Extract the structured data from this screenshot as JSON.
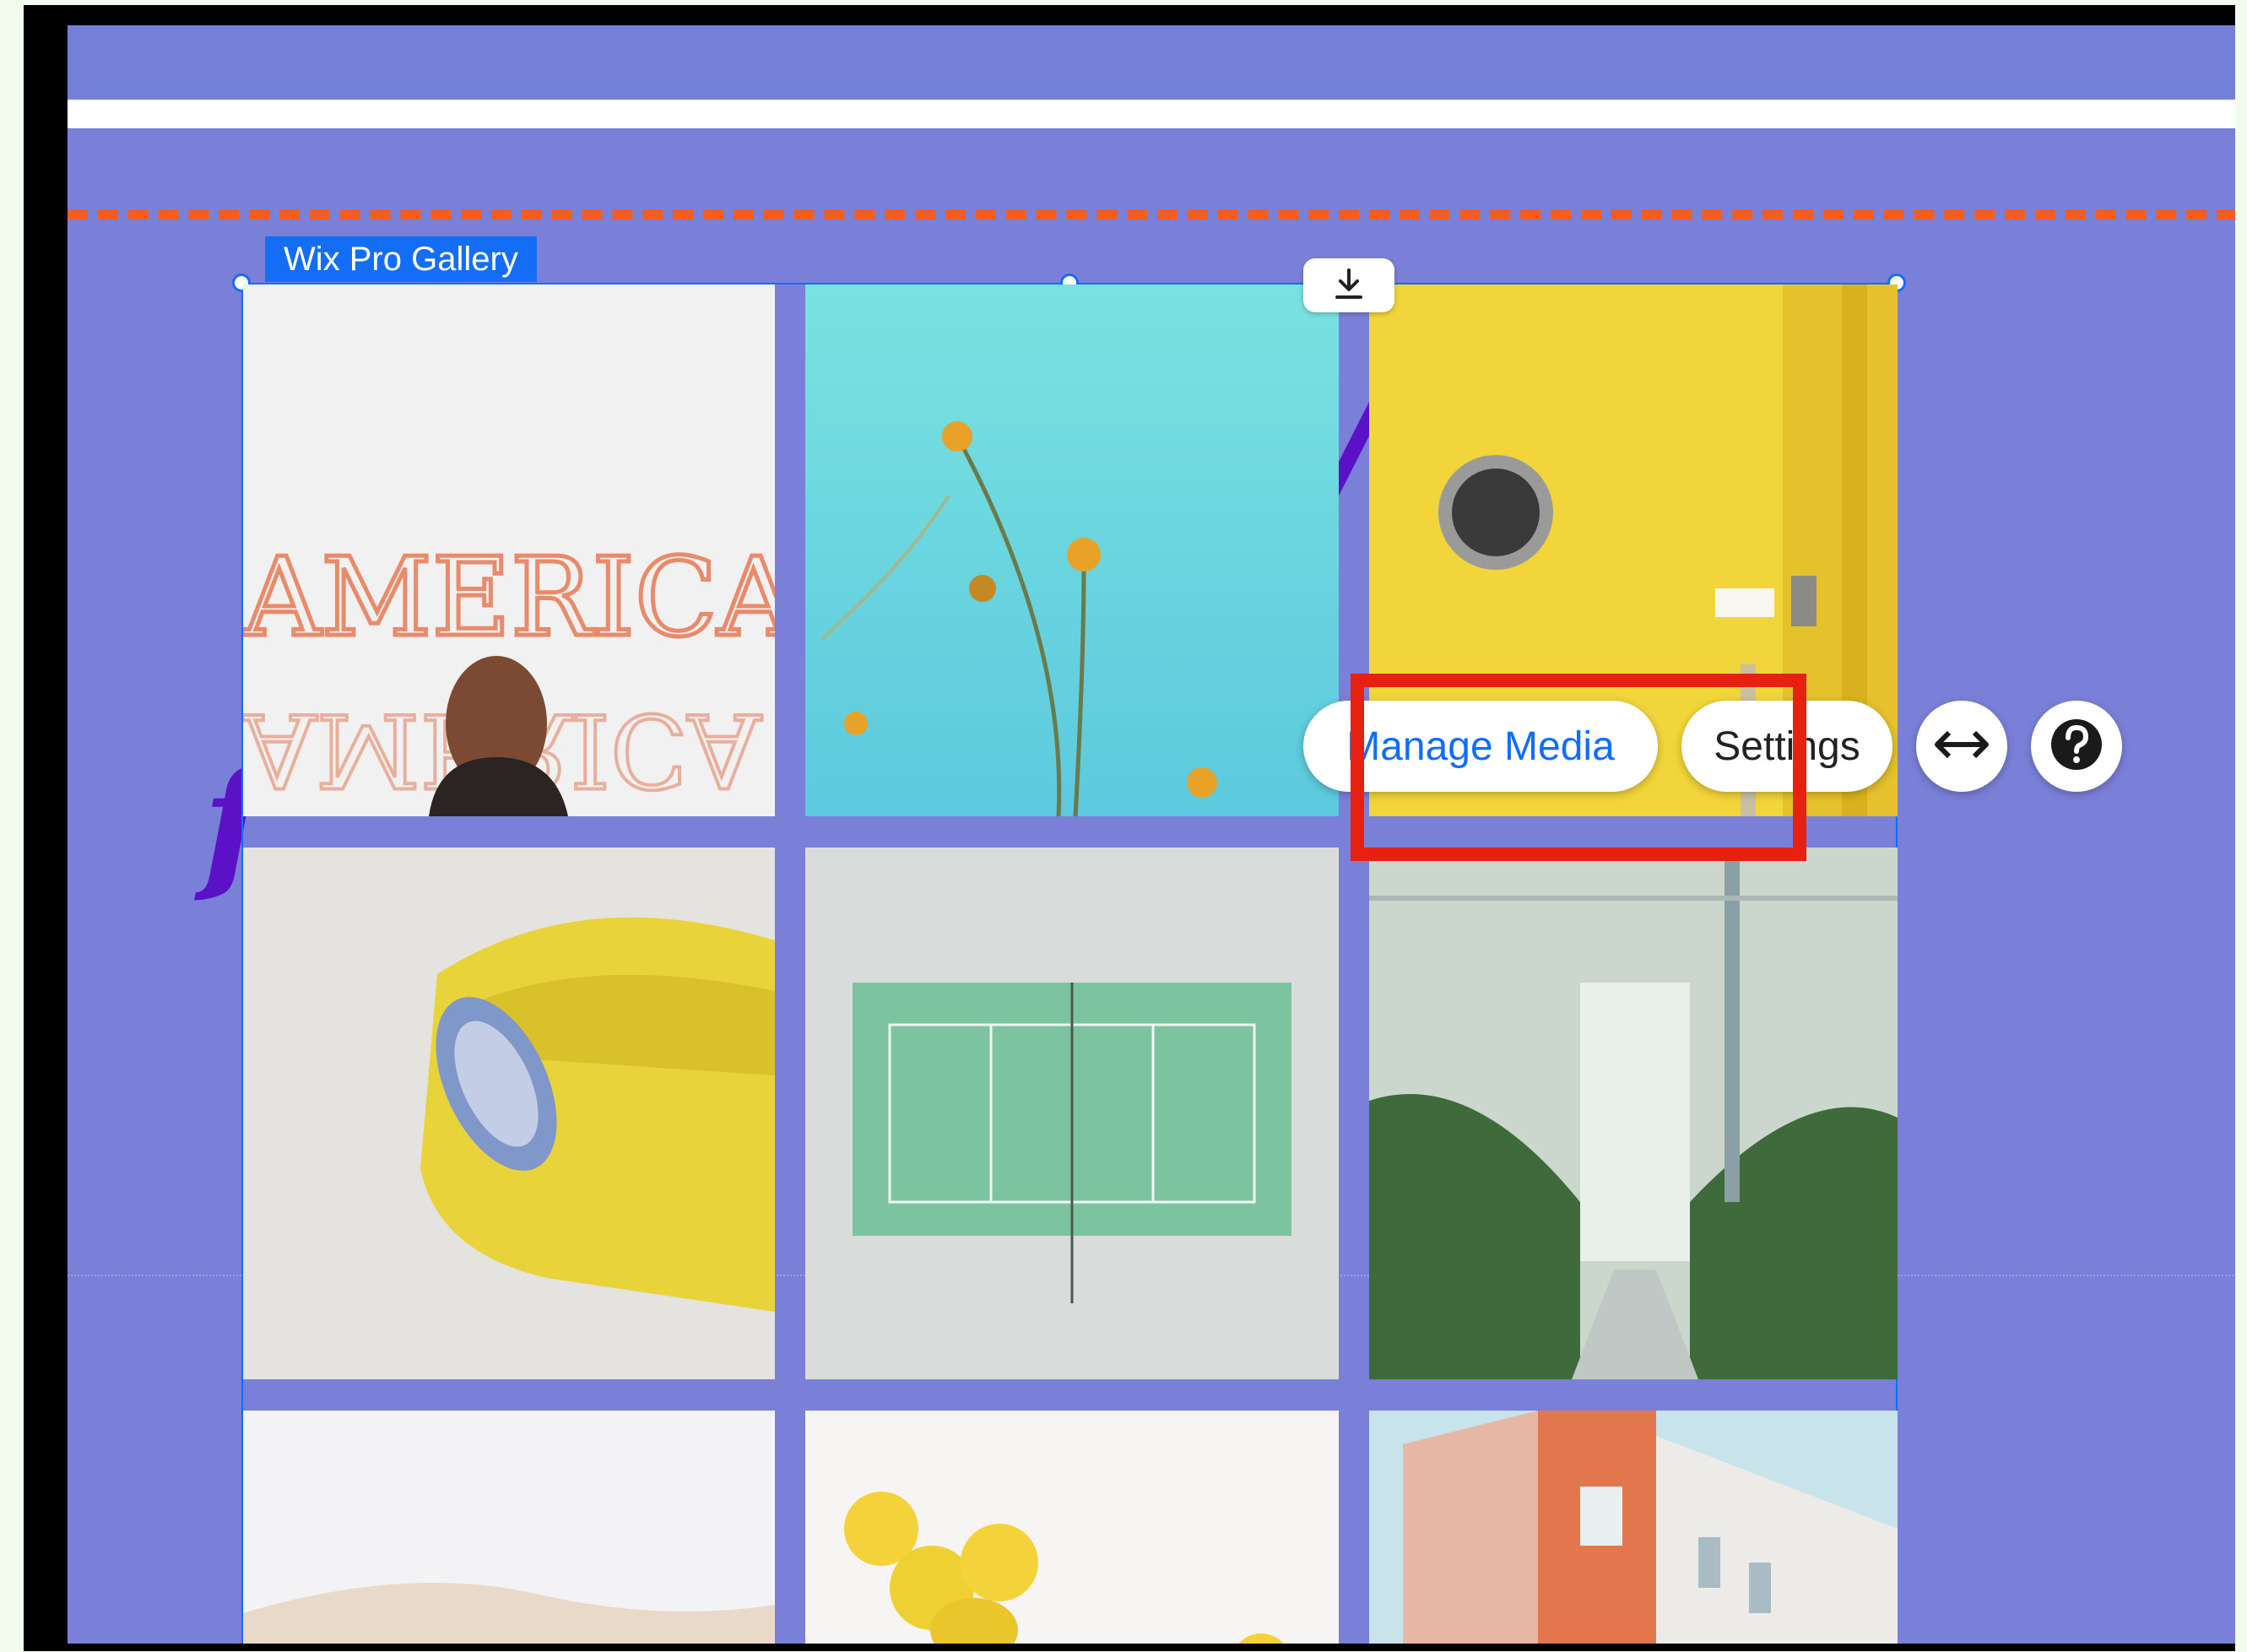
{
  "editor": {
    "component_label": "Wix Pro Gallery"
  },
  "floating_panel": {
    "manage_media_label": "Manage Media",
    "settings_label": "Settings",
    "stretch_icon": "double-arrow-icon",
    "help_icon": "question-circle-icon",
    "download_icon": "download-icon"
  },
  "gallery": {
    "images": [
      {
        "subject": "AMERICA neon sign with woman",
        "text": "AMERICA"
      },
      {
        "subject": "yellow flowers against blue sky"
      },
      {
        "subject": "yellow door with porthole"
      },
      {
        "subject": "yellow armchair with pillow"
      },
      {
        "subject": "green tennis court"
      },
      {
        "subject": "greenhouse walkway with plants"
      },
      {
        "subject": "sand dunes"
      },
      {
        "subject": "lemons on white"
      },
      {
        "subject": "pastel building facade"
      }
    ]
  },
  "colors": {
    "canvas": "#7a80d8",
    "selection": "#116dff",
    "highlight": "#e6210f",
    "dashed_guide": "#f25d22"
  }
}
